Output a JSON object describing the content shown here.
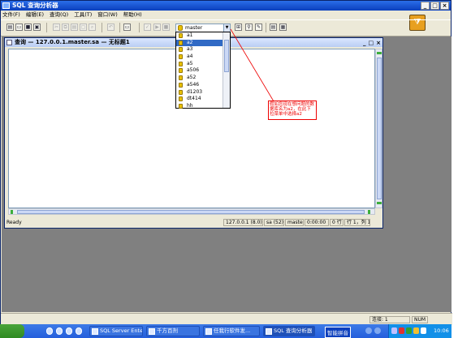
{
  "window": {
    "title": "SQL 查询分析器",
    "buttons": [
      "_",
      "□",
      "×"
    ]
  },
  "menu": [
    "文件(F)",
    "编辑(E)",
    "查询(Q)",
    "工具(T)",
    "窗口(W)",
    "帮助(H)"
  ],
  "database_combo": {
    "value": "master"
  },
  "database_list": [
    "a1",
    "a2",
    "a3",
    "a4",
    "a5",
    "a506",
    "a52",
    "a546",
    "d1203",
    "dt414",
    "hh"
  ],
  "selected_database": "a2",
  "query_window": {
    "title": "查询 — 127.0.0.1.master.sa — 无标题1",
    "buttons": [
      "_",
      "□",
      "×"
    ]
  },
  "status": {
    "ready": "Ready",
    "server": "127.0.0.1 (8.0)",
    "user": "sa (52)",
    "db": "master",
    "time": "0:00:00",
    "rows": "0 行",
    "position": "行 1，列 1"
  },
  "annotation": "假如您现在想问题的数据库名为a2，在此下拉菜单中选择a2",
  "connections": "连接: 1",
  "num": "NUM",
  "taskbar": {
    "tasks": [
      "SQL Server Ente...",
      "千方百剂",
      "任我行软件发...",
      "SQL 查询分析器"
    ],
    "ime": "智能拼音",
    "clock": "10:06"
  },
  "colors": {
    "titlebar": "#0b3fbd",
    "selection": "#316ac5",
    "callout": "#e00000"
  }
}
